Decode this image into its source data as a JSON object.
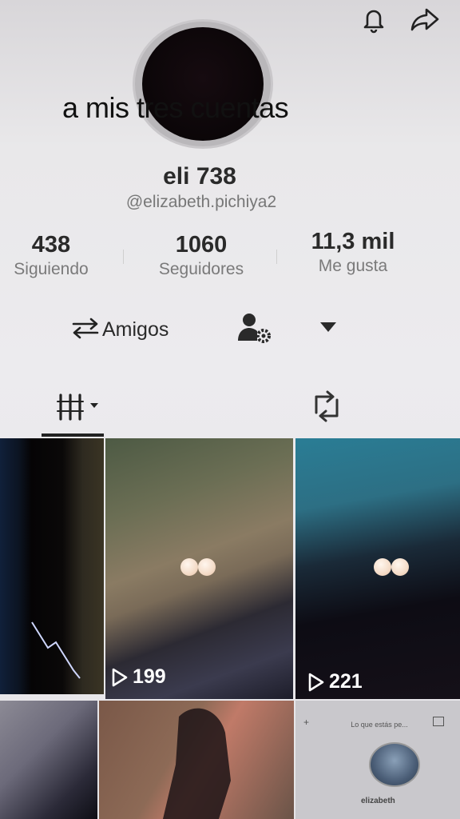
{
  "header": {
    "bell_icon": "bell-icon",
    "share_icon": "share-arrow-icon"
  },
  "profile": {
    "overlay_text": "a mis tres cuentas",
    "display_name": "eli 738",
    "username": "@elizabeth.pichiya2"
  },
  "stats": {
    "following": {
      "value": "438",
      "label": "Siguiendo"
    },
    "followers": {
      "value": "1060",
      "label": "Seguidores"
    },
    "likes": {
      "value": "11,3 mil",
      "label": "Me gusta"
    }
  },
  "actions": {
    "friends_label": "Amigos"
  },
  "tabs": {
    "grid_icon": "grid-icon",
    "reposts_icon": "repost-icon"
  },
  "videos": [
    {
      "views": ""
    },
    {
      "views": "199"
    },
    {
      "views": "221"
    },
    {
      "views": ""
    },
    {
      "views": ""
    },
    {
      "views": "",
      "caption": "Lo que estás pe...",
      "name": "elizabeth"
    }
  ],
  "colors": {
    "background": "#ecebee",
    "text_primary": "#2a2a2a",
    "text_secondary": "#7a7a7a"
  }
}
